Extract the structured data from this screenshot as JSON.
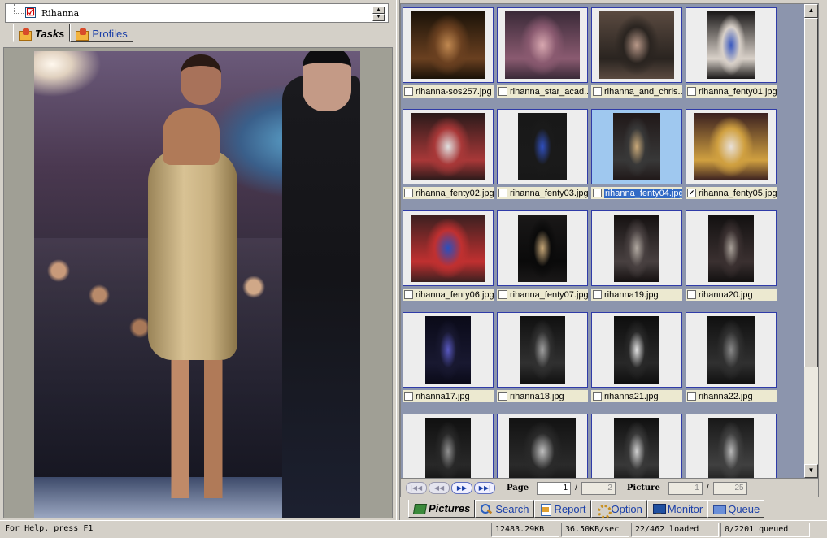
{
  "profile": {
    "name": "Rihanna",
    "checked_mark": "☑"
  },
  "left_tabs": [
    {
      "label": "Tasks",
      "active": true
    },
    {
      "label": "Profiles",
      "active": false
    }
  ],
  "thumbnails": [
    {
      "name": "rihanna-sos257.jpg",
      "checked": false,
      "selected": false,
      "tone": [
        "#1a1208",
        "#c08850",
        "#6a4020"
      ],
      "w": 92
    },
    {
      "name": "rihanna_star_acad...",
      "checked": false,
      "selected": false,
      "tone": [
        "#3a2a38",
        "#d8a8b0",
        "#8a5a70"
      ],
      "w": 92
    },
    {
      "name": "rihanna_and_chris...",
      "checked": false,
      "selected": false,
      "tone": [
        "#5a4a40",
        "#b89888",
        "#2a2420"
      ],
      "w": 92
    },
    {
      "name": "rihanna_fenty01.jpg",
      "checked": false,
      "selected": false,
      "tone": [
        "#1a1818",
        "#3858c0",
        "#d8d0c8"
      ],
      "w": 60
    },
    {
      "name": "rihanna_fenty02.jpg",
      "checked": false,
      "selected": false,
      "tone": [
        "#2a1a1a",
        "#e0e0e0",
        "#a83838"
      ],
      "w": 92
    },
    {
      "name": "rihanna_fenty03.jpg",
      "checked": false,
      "selected": false,
      "tone": [
        "#181818",
        "#3050c0",
        "#1a1a1a"
      ],
      "w": 60
    },
    {
      "name": "rihanna_fenty04.jpg",
      "checked": false,
      "selected": true,
      "tone": [
        "#201818",
        "#c8a878",
        "#383838"
      ],
      "w": 58
    },
    {
      "name": "rihanna_fenty05.jpg",
      "checked": true,
      "selected": false,
      "tone": [
        "#3a2020",
        "#e8e0d8",
        "#d0a040"
      ],
      "w": 92
    },
    {
      "name": "rihanna_fenty06.jpg",
      "checked": false,
      "selected": false,
      "tone": [
        "#3a2020",
        "#2850c0",
        "#c03030"
      ],
      "w": 92
    },
    {
      "name": "rihanna_fenty07.jpg",
      "checked": false,
      "selected": false,
      "tone": [
        "#1a1818",
        "#c8a878",
        "#0a0a0a"
      ],
      "w": 60
    },
    {
      "name": "rihanna19.jpg",
      "checked": false,
      "selected": false,
      "tone": [
        "#141010",
        "#b0a8a0",
        "#484040"
      ],
      "w": 56
    },
    {
      "name": "rihanna20.jpg",
      "checked": false,
      "selected": false,
      "tone": [
        "#121010",
        "#a8a098",
        "#3a3030"
      ],
      "w": 56
    },
    {
      "name": "rihanna17.jpg",
      "checked": false,
      "selected": false,
      "tone": [
        "#0a0a18",
        "#5858c0",
        "#181830"
      ],
      "w": 56
    },
    {
      "name": "rihanna18.jpg",
      "checked": false,
      "selected": false,
      "tone": [
        "#101010",
        "#a0a0a0",
        "#303030"
      ],
      "w": 56
    },
    {
      "name": "rihanna21.jpg",
      "checked": false,
      "selected": false,
      "tone": [
        "#0e0e0e",
        "#e0e0e0",
        "#282828"
      ],
      "w": 56
    },
    {
      "name": "rihanna22.jpg",
      "checked": false,
      "selected": false,
      "tone": [
        "#101010",
        "#888888",
        "#303030"
      ],
      "w": 60
    },
    {
      "name": "",
      "checked": false,
      "selected": false,
      "tone": [
        "#101010",
        "#909090",
        "#282828"
      ],
      "w": 56
    },
    {
      "name": "",
      "checked": false,
      "selected": false,
      "tone": [
        "#121212",
        "#c0c0c0",
        "#2a2a2a"
      ],
      "w": 82
    },
    {
      "name": "",
      "checked": false,
      "selected": false,
      "tone": [
        "#101010",
        "#d0d0d0",
        "#383838"
      ],
      "w": 56
    },
    {
      "name": "",
      "checked": false,
      "selected": false,
      "tone": [
        "#181818",
        "#b8b8b8",
        "#404040"
      ],
      "w": 56
    }
  ],
  "pager": {
    "page_label": "Page",
    "page_current": "1",
    "page_total": "2",
    "picture_label": "Picture",
    "picture_current": "1",
    "picture_total": "25",
    "slash": "/",
    "first_glyph": "|◀◀",
    "prev_glyph": "◀◀",
    "next_glyph": "▶▶",
    "last_glyph": "▶▶|"
  },
  "bottom_tabs": [
    {
      "label": "Pictures",
      "icon": "pictures-icon",
      "active": true
    },
    {
      "label": "Search",
      "icon": "search-icon",
      "active": false
    },
    {
      "label": "Report",
      "icon": "report-icon",
      "active": false
    },
    {
      "label": "Option",
      "icon": "option-icon",
      "active": false
    },
    {
      "label": "Monitor",
      "icon": "monitor-icon",
      "active": false
    },
    {
      "label": "Queue",
      "icon": "queue-icon",
      "active": false
    }
  ],
  "status": {
    "help": "For Help, press F1",
    "size": "12483.29KB",
    "speed": "36.50KB/sec",
    "loaded": "22/462 loaded",
    "queued": "0/2201 queued"
  },
  "colors": {
    "accent": "#1a3fa8",
    "selection": "#316ac5",
    "thumb_border": "#2f3ba8",
    "gallery_bg": "#8c95ad"
  }
}
